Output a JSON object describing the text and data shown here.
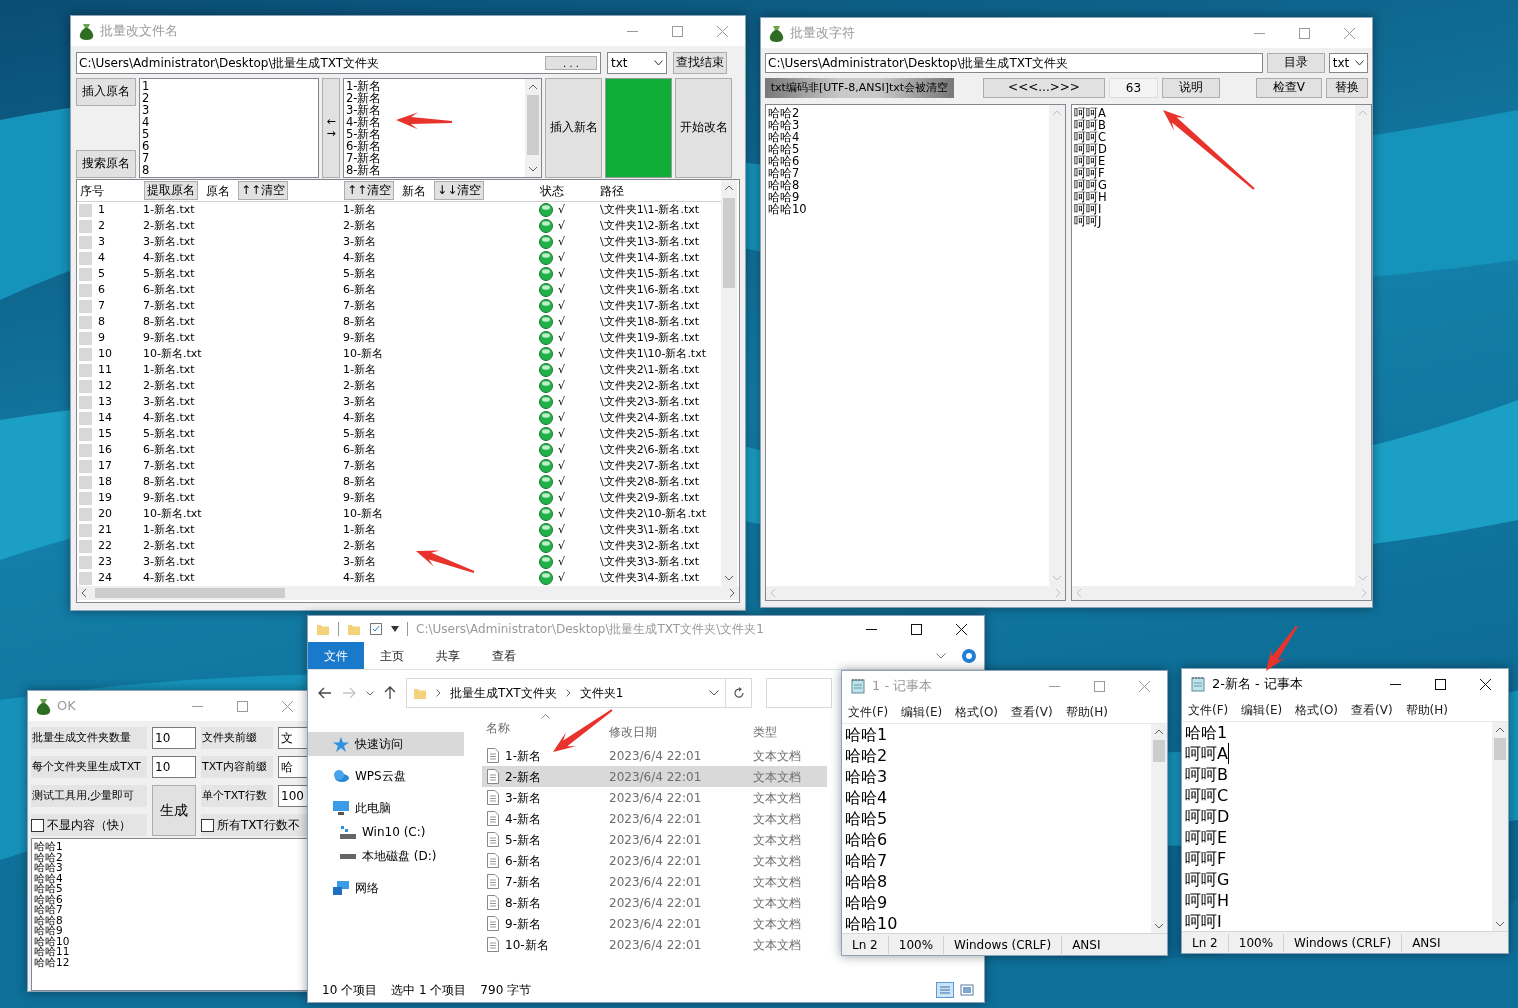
{
  "rename_window": {
    "title": "批量改文件名",
    "path": "C:\\Users\\Administrator\\Desktop\\批量生成TXT文件夹",
    "browse_button": ". . .",
    "extension": "txt",
    "find_end_button": "查找结束",
    "insert_original_button": "插入原名",
    "search_original_button": "搜索原名",
    "original_lines": [
      "1",
      "2",
      "3",
      "4",
      "5",
      "6",
      "7",
      "8"
    ],
    "swap_arrows": [
      "←",
      "→"
    ],
    "new_lines": [
      "1-新名",
      "2-新名",
      "3-新名",
      "4-新名",
      "5-新名",
      "6-新名",
      "7-新名",
      "8-新名"
    ],
    "insert_new_button": "插入新名",
    "progress": {
      "level": 1
    },
    "start_button": "开始改名",
    "header": {
      "index_label": "序号",
      "extract_button": "提取原名",
      "original_label": "原名",
      "clear_original_button": "↑↑清空",
      "clear_new_up_button": "↑↑清空",
      "new_label": "新名",
      "clear_new_down_button": "↓↓清空",
      "status_label": "状态",
      "path_label": "路径"
    },
    "rows": [
      {
        "no": "1",
        "original": "1-新名.txt",
        "new": "1-新名",
        "ok": true,
        "mark": "√",
        "path": "\\文件夹1\\1-新名.txt"
      },
      {
        "no": "2",
        "original": "2-新名.txt",
        "new": "2-新名",
        "ok": true,
        "mark": "√",
        "path": "\\文件夹1\\2-新名.txt"
      },
      {
        "no": "3",
        "original": "3-新名.txt",
        "new": "3-新名",
        "ok": true,
        "mark": "√",
        "path": "\\文件夹1\\3-新名.txt"
      },
      {
        "no": "4",
        "original": "4-新名.txt",
        "new": "4-新名",
        "ok": true,
        "mark": "√",
        "path": "\\文件夹1\\4-新名.txt"
      },
      {
        "no": "5",
        "original": "5-新名.txt",
        "new": "5-新名",
        "ok": true,
        "mark": "√",
        "path": "\\文件夹1\\5-新名.txt"
      },
      {
        "no": "6",
        "original": "6-新名.txt",
        "new": "6-新名",
        "ok": true,
        "mark": "√",
        "path": "\\文件夹1\\6-新名.txt"
      },
      {
        "no": "7",
        "original": "7-新名.txt",
        "new": "7-新名",
        "ok": true,
        "mark": "√",
        "path": "\\文件夹1\\7-新名.txt"
      },
      {
        "no": "8",
        "original": "8-新名.txt",
        "new": "8-新名",
        "ok": true,
        "mark": "√",
        "path": "\\文件夹1\\8-新名.txt"
      },
      {
        "no": "9",
        "original": "9-新名.txt",
        "new": "9-新名",
        "ok": true,
        "mark": "√",
        "path": "\\文件夹1\\9-新名.txt"
      },
      {
        "no": "10",
        "original": "10-新名.txt",
        "new": "10-新名",
        "ok": true,
        "mark": "√",
        "path": "\\文件夹1\\10-新名.txt"
      },
      {
        "no": "11",
        "original": "1-新名.txt",
        "new": "1-新名",
        "ok": true,
        "mark": "√",
        "path": "\\文件夹2\\1-新名.txt"
      },
      {
        "no": "12",
        "original": "2-新名.txt",
        "new": "2-新名",
        "ok": true,
        "mark": "√",
        "path": "\\文件夹2\\2-新名.txt"
      },
      {
        "no": "13",
        "original": "3-新名.txt",
        "new": "3-新名",
        "ok": true,
        "mark": "√",
        "path": "\\文件夹2\\3-新名.txt"
      },
      {
        "no": "14",
        "original": "4-新名.txt",
        "new": "4-新名",
        "ok": true,
        "mark": "√",
        "path": "\\文件夹2\\4-新名.txt"
      },
      {
        "no": "15",
        "original": "5-新名.txt",
        "new": "5-新名",
        "ok": true,
        "mark": "√",
        "path": "\\文件夹2\\5-新名.txt"
      },
      {
        "no": "16",
        "original": "6-新名.txt",
        "new": "6-新名",
        "ok": true,
        "mark": "√",
        "path": "\\文件夹2\\6-新名.txt"
      },
      {
        "no": "17",
        "original": "7-新名.txt",
        "new": "7-新名",
        "ok": true,
        "mark": "√",
        "path": "\\文件夹2\\7-新名.txt"
      },
      {
        "no": "18",
        "original": "8-新名.txt",
        "new": "8-新名",
        "ok": true,
        "mark": "√",
        "path": "\\文件夹2\\8-新名.txt"
      },
      {
        "no": "19",
        "original": "9-新名.txt",
        "new": "9-新名",
        "ok": true,
        "mark": "√",
        "path": "\\文件夹2\\9-新名.txt"
      },
      {
        "no": "20",
        "original": "10-新名.txt",
        "new": "10-新名",
        "ok": true,
        "mark": "√",
        "path": "\\文件夹2\\10-新名.txt"
      },
      {
        "no": "21",
        "original": "1-新名.txt",
        "new": "1-新名",
        "ok": true,
        "mark": "√",
        "path": "\\文件夹3\\1-新名.txt"
      },
      {
        "no": "22",
        "original": "2-新名.txt",
        "new": "2-新名",
        "ok": true,
        "mark": "√",
        "path": "\\文件夹3\\2-新名.txt"
      },
      {
        "no": "23",
        "original": "3-新名.txt",
        "new": "3-新名",
        "ok": true,
        "mark": "√",
        "path": "\\文件夹3\\3-新名.txt"
      },
      {
        "no": "24",
        "original": "4-新名.txt",
        "new": "4-新名",
        "ok": true,
        "mark": "√",
        "path": "\\文件夹3\\4-新名.txt"
      }
    ]
  },
  "replace_window": {
    "title": "批量改字符",
    "path": "C:\\Users\\Administrator\\Desktop\\批量生成TXT文件夹",
    "directory_button": "目录",
    "extension": "txt",
    "warning": "txt编码非[UTF-8,ANSI]txt会被清空",
    "range_button": "<<<...>>>",
    "count": "63",
    "help_button": "说明",
    "check_button": "检查V",
    "replace_button": "替换",
    "find_lines": [
      "哈哈2",
      "哈哈3",
      "哈哈4",
      "哈哈5",
      "哈哈6",
      "哈哈7",
      "哈哈8",
      "哈哈9",
      "哈哈10"
    ],
    "replace_lines": [
      "呵呵A",
      "呵呵B",
      "呵呵C",
      "呵呵D",
      "呵呵E",
      "呵呵F",
      "呵呵G",
      "呵呵H",
      "呵呵I",
      "呵呵J"
    ]
  },
  "generator_window": {
    "title": "OK",
    "left_fields": [
      {
        "label": "批量生成文件夹数量",
        "value": "10"
      },
      {
        "label": "每个文件夹里生成TXT",
        "value": "10"
      }
    ],
    "right_fields": [
      {
        "label": "文件夹前缀",
        "value": "文"
      },
      {
        "label": "TXT内容前缀",
        "value": "哈"
      },
      {
        "label": "单个TXT行数",
        "value": "100"
      }
    ],
    "note": "测试工具用,少量即可",
    "generate_button": "生成",
    "fast_checkbox": {
      "label": "不显内容（快）",
      "checked": false
    },
    "uniform_checkbox": {
      "label": "所有TXT行数不",
      "checked": false
    },
    "output_lines": [
      "哈哈1",
      "哈哈2",
      "哈哈3",
      "哈哈4",
      "哈哈5",
      "哈哈6",
      "哈哈7",
      "哈哈8",
      "哈哈9",
      "哈哈10",
      "哈哈11",
      "哈哈12"
    ]
  },
  "explorer": {
    "title_path": "C:\\Users\\Administrator\\Desktop\\批量生成TXT文件夹\\文件夹1",
    "ribbon_tabs": [
      {
        "label": "文件",
        "selected": true
      },
      {
        "label": "主页",
        "selected": false
      },
      {
        "label": "共享",
        "selected": false
      },
      {
        "label": "查看",
        "selected": false
      }
    ],
    "breadcrumb": [
      "批量生成TXT文件夹",
      "文件夹1"
    ],
    "nav": [
      {
        "label": "快速访问",
        "selected": true
      },
      {
        "label": "WPS云盘",
        "selected": false
      },
      {
        "label": "此电脑",
        "selected": false,
        "children": [
          {
            "label": "Win10 (C:)",
            "selected": false
          },
          {
            "label": "本地磁盘 (D:)",
            "selected": false
          }
        ]
      },
      {
        "label": "网络",
        "selected": false
      }
    ],
    "columns": [
      "名称",
      "修改日期",
      "类型"
    ],
    "files": [
      {
        "name": "1-新名",
        "modified": "2023/6/4 22:01",
        "type": "文本文档",
        "selected": false
      },
      {
        "name": "2-新名",
        "modified": "2023/6/4 22:01",
        "type": "文本文档",
        "selected": true
      },
      {
        "name": "3-新名",
        "modified": "2023/6/4 22:01",
        "type": "文本文档",
        "selected": false
      },
      {
        "name": "4-新名",
        "modified": "2023/6/4 22:01",
        "type": "文本文档",
        "selected": false
      },
      {
        "name": "5-新名",
        "modified": "2023/6/4 22:01",
        "type": "文本文档",
        "selected": false
      },
      {
        "name": "6-新名",
        "modified": "2023/6/4 22:01",
        "type": "文本文档",
        "selected": false
      },
      {
        "name": "7-新名",
        "modified": "2023/6/4 22:01",
        "type": "文本文档",
        "selected": false
      },
      {
        "name": "8-新名",
        "modified": "2023/6/4 22:01",
        "type": "文本文档",
        "selected": false
      },
      {
        "name": "9-新名",
        "modified": "2023/6/4 22:01",
        "type": "文本文档",
        "selected": false
      },
      {
        "name": "10-新名",
        "modified": "2023/6/4 22:01",
        "type": "文本文档",
        "selected": false
      }
    ],
    "status": {
      "count": "10 个项目",
      "selection": "选中 1 个项目",
      "size": "790 字节"
    }
  },
  "notepads": [
    {
      "title": "1 - 记事本",
      "active": false,
      "menu": [
        "文件(F)",
        "编辑(E)",
        "格式(O)",
        "查看(V)",
        "帮助(H)"
      ],
      "lines": [
        {
          "text": "哈哈1",
          "caret": false
        },
        {
          "text": "哈哈2",
          "caret": false
        },
        {
          "text": "哈哈3",
          "caret": false
        },
        {
          "text": "哈哈4",
          "caret": false
        },
        {
          "text": "哈哈5",
          "caret": false
        },
        {
          "text": "哈哈6",
          "caret": false
        },
        {
          "text": "哈哈7",
          "caret": false
        },
        {
          "text": "哈哈8",
          "caret": false
        },
        {
          "text": "哈哈9",
          "caret": false
        },
        {
          "text": "哈哈10",
          "caret": false
        }
      ],
      "status": [
        "Ln 2",
        "100%",
        "Windows (CRLF)",
        "ANSI"
      ]
    },
    {
      "title": "2-新名 - 记事本",
      "active": true,
      "menu": [
        "文件(F)",
        "编辑(E)",
        "格式(O)",
        "查看(V)",
        "帮助(H)"
      ],
      "lines": [
        {
          "text": "哈哈1",
          "caret": false
        },
        {
          "text": "呵呵A",
          "caret": true
        },
        {
          "text": "呵呵B",
          "caret": false
        },
        {
          "text": "呵呵C",
          "caret": false
        },
        {
          "text": "呵呵D",
          "caret": false
        },
        {
          "text": "呵呵E",
          "caret": false
        },
        {
          "text": "呵呵F",
          "caret": false
        },
        {
          "text": "呵呵G",
          "caret": false
        },
        {
          "text": "呵呵H",
          "caret": false
        },
        {
          "text": "呵呵I",
          "caret": false
        }
      ],
      "status": [
        "Ln 2",
        "100%",
        "Windows (CRLF)",
        "ANSI"
      ]
    }
  ]
}
